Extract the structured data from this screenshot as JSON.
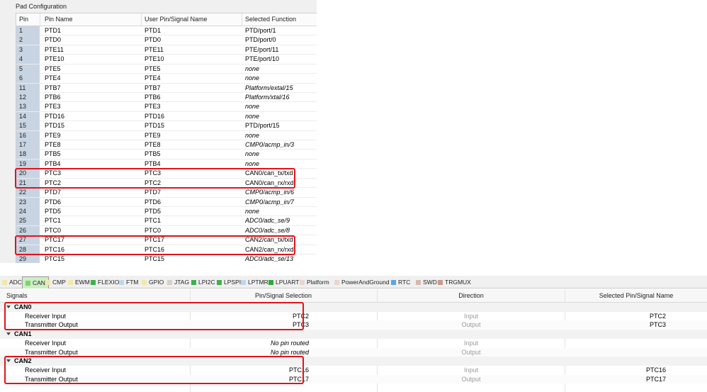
{
  "pad_config": {
    "title": "Pad Configuration",
    "columns": [
      "Pin",
      "Pin Name",
      "User Pin/Signal Name",
      "Selected Function"
    ],
    "rows": [
      {
        "pin": "1",
        "name": "PTD1",
        "signal": "PTD1",
        "function": "PTD/port/1",
        "italic": false
      },
      {
        "pin": "2",
        "name": "PTD0",
        "signal": "PTD0",
        "function": "PTD/port/0",
        "italic": false
      },
      {
        "pin": "3",
        "name": "PTE11",
        "signal": "PTE11",
        "function": "PTE/port/11",
        "italic": false
      },
      {
        "pin": "4",
        "name": "PTE10",
        "signal": "PTE10",
        "function": "PTE/port/10",
        "italic": false
      },
      {
        "pin": "5",
        "name": "PTE5",
        "signal": "PTE5",
        "function": "none",
        "italic": true
      },
      {
        "pin": "6",
        "name": "PTE4",
        "signal": "PTE4",
        "function": "none",
        "italic": true
      },
      {
        "pin": "11",
        "name": "PTB7",
        "signal": "PTB7",
        "function": "Platform/extal/15",
        "italic": true
      },
      {
        "pin": "12",
        "name": "PTB6",
        "signal": "PTB6",
        "function": "Platform/xtal/16",
        "italic": true
      },
      {
        "pin": "13",
        "name": "PTE3",
        "signal": "PTE3",
        "function": "none",
        "italic": true
      },
      {
        "pin": "14",
        "name": "PTD16",
        "signal": "PTD16",
        "function": "none",
        "italic": true
      },
      {
        "pin": "15",
        "name": "PTD15",
        "signal": "PTD15",
        "function": "PTD/port/15",
        "italic": false
      },
      {
        "pin": "16",
        "name": "PTE9",
        "signal": "PTE9",
        "function": "none",
        "italic": true
      },
      {
        "pin": "17",
        "name": "PTE8",
        "signal": "PTE8",
        "function": "CMP0/acmp_in/3",
        "italic": true
      },
      {
        "pin": "18",
        "name": "PTB5",
        "signal": "PTB5",
        "function": "none",
        "italic": true
      },
      {
        "pin": "19",
        "name": "PTB4",
        "signal": "PTB4",
        "function": "none",
        "italic": true
      },
      {
        "pin": "20",
        "name": "PTC3",
        "signal": "PTC3",
        "function": "CAN0/can_tx/txd",
        "italic": false
      },
      {
        "pin": "21",
        "name": "PTC2",
        "signal": "PTC2",
        "function": "CAN0/can_rx/rxd",
        "italic": false
      },
      {
        "pin": "22",
        "name": "PTD7",
        "signal": "PTD7",
        "function": "CMP0/acmp_in/6",
        "italic": true
      },
      {
        "pin": "23",
        "name": "PTD6",
        "signal": "PTD6",
        "function": "CMP0/acmp_in/7",
        "italic": true
      },
      {
        "pin": "24",
        "name": "PTD5",
        "signal": "PTD5",
        "function": "none",
        "italic": true
      },
      {
        "pin": "25",
        "name": "PTC1",
        "signal": "PTC1",
        "function": "ADC0/adc_se/9",
        "italic": true
      },
      {
        "pin": "26",
        "name": "PTC0",
        "signal": "PTC0",
        "function": "ADC0/adc_se/8",
        "italic": true
      },
      {
        "pin": "27",
        "name": "PTC17",
        "signal": "PTC17",
        "function": "CAN2/can_tx/txd",
        "italic": false
      },
      {
        "pin": "28",
        "name": "PTC16",
        "signal": "PTC16",
        "function": "CAN2/can_rx/rxd",
        "italic": false
      },
      {
        "pin": "29",
        "name": "PTC15",
        "signal": "PTC15",
        "function": "ADC0/adc_se/13",
        "italic": true
      }
    ]
  },
  "tabs": [
    {
      "label": "ADC",
      "color": "#f2e9a8",
      "active": false
    },
    {
      "label": "CAN",
      "color": "#7fd36b",
      "active": true
    },
    {
      "label": "CMP",
      "color": "#f2e9a8",
      "active": false
    },
    {
      "label": "EWM",
      "color": "#f2e9a8",
      "active": false
    },
    {
      "label": "FLEXIO",
      "color": "#3bb34a",
      "active": false
    },
    {
      "label": "FTM",
      "color": "#bcd7ee",
      "active": false
    },
    {
      "label": "GPIO",
      "color": "#f2e9a8",
      "active": false
    },
    {
      "label": "JTAG",
      "color": "#d8cfc6",
      "active": false
    },
    {
      "label": "LPI2C",
      "color": "#3bb34a",
      "active": false
    },
    {
      "label": "LPSPI",
      "color": "#3bb34a",
      "active": false
    },
    {
      "label": "LPTMR",
      "color": "#bcd7ee",
      "active": false
    },
    {
      "label": "LPUART",
      "color": "#2ea83c",
      "active": false
    },
    {
      "label": "Platform",
      "color": "#e8d5d0",
      "active": false
    },
    {
      "label": "PowerAndGround",
      "color": "#e8d5d0",
      "active": false
    },
    {
      "label": "RTC",
      "color": "#5aa6e0",
      "active": false
    },
    {
      "label": "SWD",
      "color": "#d8b8ae",
      "active": false
    },
    {
      "label": "TRGMUX",
      "color": "#c89a8a",
      "active": false
    }
  ],
  "signals": {
    "columns": [
      "Signals",
      "Pin/Signal Selection",
      "Direction",
      "Selected Pin/Signal Name"
    ],
    "groups": [
      {
        "name": "CAN0",
        "rows": [
          {
            "signal": "Receiver Input",
            "selection": "PTC2",
            "direction": "Input",
            "name": "PTC2",
            "italic": false
          },
          {
            "signal": "Transmitter Output",
            "selection": "PTC3",
            "direction": "Output",
            "name": "PTC3",
            "italic": false
          }
        ]
      },
      {
        "name": "CAN1",
        "rows": [
          {
            "signal": "Receiver Input",
            "selection": "No pin routed",
            "direction": "Input",
            "name": "",
            "italic": true
          },
          {
            "signal": "Transmitter Output",
            "selection": "No pin routed",
            "direction": "Output",
            "name": "",
            "italic": true
          }
        ]
      },
      {
        "name": "CAN2",
        "rows": [
          {
            "signal": "Receiver Input",
            "selection": "PTC16",
            "direction": "Input",
            "name": "PTC16",
            "italic": false
          },
          {
            "signal": "Transmitter Output",
            "selection": "PTC17",
            "direction": "Output",
            "name": "PTC17",
            "italic": false
          }
        ]
      }
    ]
  },
  "colors": {
    "highlight": "#e0141c",
    "active_tab": "#cdeec5",
    "pin_cell": "#c8d4e2"
  }
}
